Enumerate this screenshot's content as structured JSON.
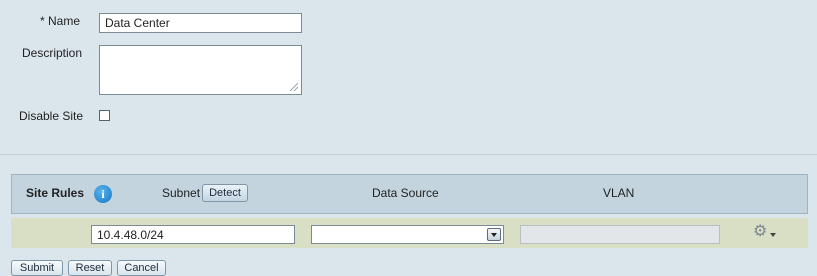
{
  "form": {
    "name_label": "* Name",
    "name_value": "Data Center",
    "description_label": "Description",
    "description_value": "",
    "disable_site_label": "Disable Site",
    "disable_site_checked": false
  },
  "site_rules": {
    "title": "Site Rules",
    "info_icon": "i",
    "columns": {
      "subnet": "Subnet",
      "detect_button": "Detect",
      "data_source": "Data Source",
      "vlan": "VLAN"
    },
    "rows": [
      {
        "subnet": "10.4.48.0/24",
        "data_source": "",
        "vlan": ""
      }
    ],
    "gear_icon": "gear-icon"
  },
  "actions": {
    "submit": "Submit",
    "reset": "Reset",
    "cancel": "Cancel"
  }
}
